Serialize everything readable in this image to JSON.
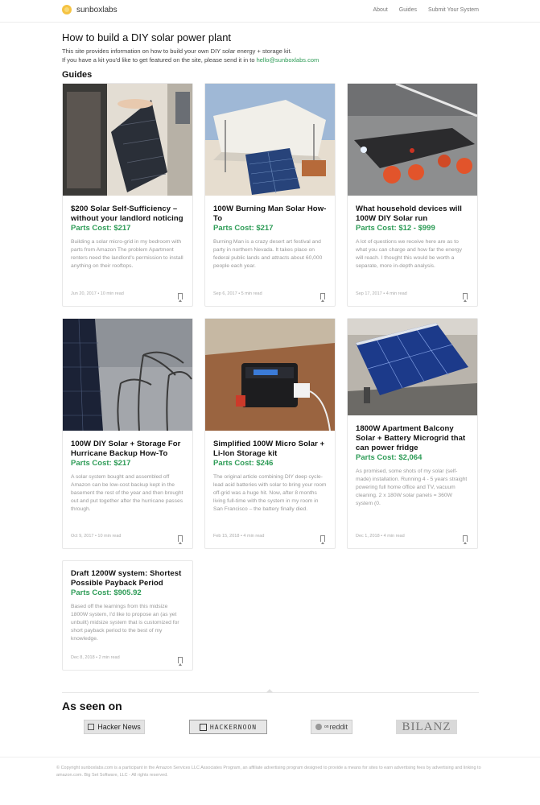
{
  "brand": {
    "name": "sunboxlabs"
  },
  "nav": {
    "items": [
      "About",
      "Guides",
      "Submit Your System"
    ]
  },
  "page": {
    "title": "How to build a DIY solar power plant",
    "intro_line1": "This site provides information on how to build your own DIY solar energy + storage kit.",
    "intro_line2_prefix": "If you have a kit you'd like to get featured on the site, please send it in to ",
    "intro_email": "hello@sunboxlabs.com",
    "guides_heading": "Guides"
  },
  "cards": [
    {
      "title": "$200 Solar Self-Sufficiency – without your landlord noticing",
      "cost": "Parts Cost: $217",
      "desc": "Building a solar micro-grid in my bedroom with parts from Amazon The problem Apartment renters need the landlord's permission to install anything on their rooftops.",
      "meta": "Jun 20, 2017 • 10 min read",
      "image": "window-solar-panel"
    },
    {
      "title": "100W Burning Man Solar How-To",
      "cost": "Parts Cost: $217",
      "desc": "Burning Man is a crazy desert art festival and party in northern Nevada. It takes place on federal public lands and attracts about 60,000 people each year.",
      "meta": "Sep 6, 2017 • 5 min read",
      "image": "desert-tent-solar"
    },
    {
      "title": "What household devices will 100W DIY Solar run",
      "cost": "Parts Cost: $12 - $999",
      "desc": "A lot of questions we receive here are as to what you can charge and how far the energy will reach. I thought this would be worth a separate, more in-depth analysis.",
      "meta": "Sep 17, 2017 • 4 min read",
      "image": "electric-skateboard"
    },
    {
      "title": "100W DIY Solar + Storage For Hurricane Backup How-To",
      "cost": "Parts Cost: $217",
      "desc": "A solar system bought and assembled off Amazon can be low-cost backup kept in the basement the rest of the year and then brought out and put together after the hurricane passes through.",
      "meta": "Oct 9, 2017 • 10 min read",
      "image": "hurricane-palms"
    },
    {
      "title": "Simplified 100W Micro Solar + Li-Ion Storage kit",
      "cost": "Parts Cost: $246",
      "desc": "The original article combining DIY deep cycle-lead acid batteries with solar to bring your room off-grid was a huge hit. Now, after 8 months living full-time with the system in my room in San Francisco – the battery finally died.",
      "meta": "Feb 15, 2018 • 4 min read",
      "image": "power-station"
    },
    {
      "title": "1800W Apartment Balcony Solar + Battery Microgrid that can power fridge",
      "cost": "Parts Cost: $2,064",
      "desc": "As promised, some shots of my solar (self-made) installation. Running 4 - 5 years straight powering full home office and TV, vacuum cleaning. 2 x 180W solar panels = 360W system (0.",
      "meta": "Dec 1, 2018 • 4 min read",
      "image": "balcony-panels"
    },
    {
      "title": "Draft 1200W system: Shortest Possible Payback Period",
      "cost": "Parts Cost: $905.92",
      "desc": "Based off the learnings from this midsize 1800W system, I'd like to propose an (as yet unbuilt) midsize system that is customized for short payback period to the best of my knowledge.",
      "meta": "Dec 8, 2018 • 2 min read",
      "image": ""
    }
  ],
  "seen_on": {
    "heading": "As seen on",
    "logos": [
      "Hacker News",
      "HACKERNOON",
      "reddit",
      "BILANZ"
    ],
    "reddit_small": "on"
  },
  "footer": {
    "text": "© Copyright sunboxlabs.com is a participant in the Amazon Services LLC Associates Program, an affiliate advertising program designed to provide a means for sites to earn advertising fees by advertising and linking to amazon.com. Big Set Software, LLC - All rights reserved."
  },
  "colors": {
    "accent_green": "#2e9c57",
    "brand_sun": "#f5c343"
  }
}
